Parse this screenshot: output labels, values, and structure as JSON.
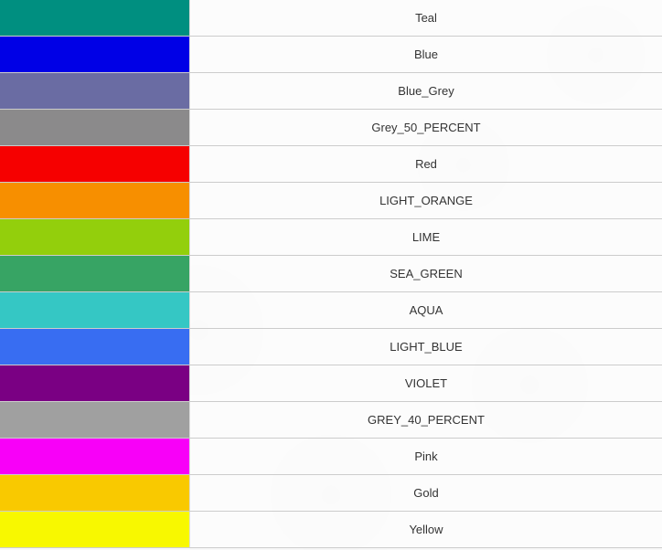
{
  "rows": [
    {
      "color": "#008f80",
      "label": "Teal"
    },
    {
      "color": "#0000e6",
      "label": "Blue"
    },
    {
      "color": "#6a6ca3",
      "label": "Blue_Grey"
    },
    {
      "color": "#8b8a8b",
      "label": "Grey_50_PERCENT"
    },
    {
      "color": "#f60000",
      "label": "Red"
    },
    {
      "color": "#f78f00",
      "label": "LIGHT_ORANGE"
    },
    {
      "color": "#93cf0c",
      "label": "LIME"
    },
    {
      "color": "#37a464",
      "label": "SEA_GREEN"
    },
    {
      "color": "#35c7c4",
      "label": "AQUA"
    },
    {
      "color": "#386df2",
      "label": "LIGHT_BLUE"
    },
    {
      "color": "#7a0083",
      "label": "VIOLET"
    },
    {
      "color": "#a0a0a0",
      "label": "GREY_40_PERCENT"
    },
    {
      "color": "#f800f8",
      "label": "Pink"
    },
    {
      "color": "#f9c900",
      "label": "Gold"
    },
    {
      "color": "#f8f800",
      "label": "Yellow"
    }
  ]
}
